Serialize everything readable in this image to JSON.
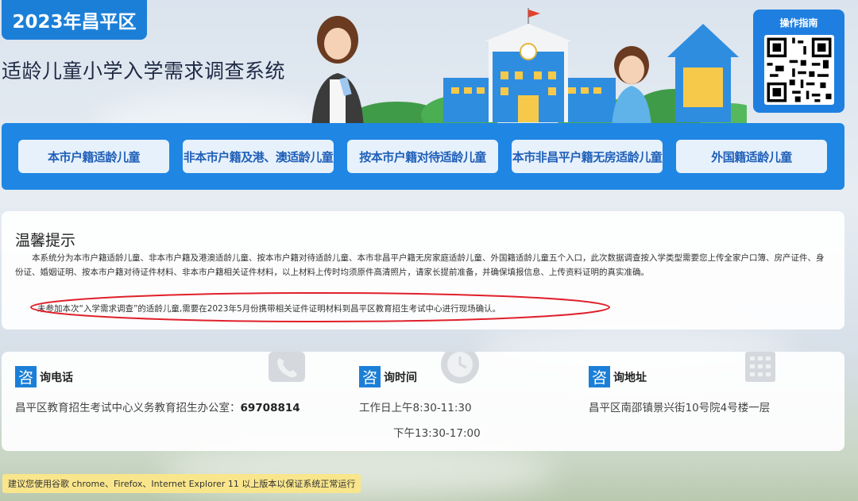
{
  "header": {
    "region_badge": "2023年昌平区",
    "system_title": "适龄儿童小学入学需求调查系统",
    "guide_label": "操作指南"
  },
  "nav": {
    "buttons": [
      "本市户籍适龄儿童",
      "非本市户籍及港、澳适龄儿童",
      "按本市户籍对待适龄儿童",
      "本市非昌平户籍无房适龄儿童",
      "外国籍适龄儿童"
    ]
  },
  "tips": {
    "title": "温馨提示",
    "body": "本系统分为本市户籍适龄儿童、非本市户籍及港澳适龄儿童、按本市户籍对待适龄儿童、本市非昌平户籍无房家庭适龄儿童、外国籍适龄儿童五个入口，此次数据调查按入学类型需要您上传全家户口簿、房产证件、身份证、婚姻证明、按本市户籍对待证件材料、非本市户籍相关证件材料，以上材料上传时均须原件高清照片，请家长提前准备，并确保填报信息、上传资料证明的真实准确。",
    "note": "未参加本次“入学需求调查”的适龄儿童,需要在2023年5月份携带相关证件证明材料到昌平区教育招生考试中心进行现场确认。"
  },
  "contact": {
    "zi": "咨",
    "phone": {
      "title": "询电话",
      "office": "昌平区教育招生考试中心义务教育招生办公室：",
      "number": "69708814"
    },
    "hours": {
      "title": "询时间",
      "weekday": "工作日上午8:30-11:30",
      "afternoon": "下午13:30-17:00"
    },
    "address": {
      "title": "询地址",
      "text": "昌平区南邵镇景兴街10号院4号楼一层"
    }
  },
  "footer": {
    "browser_notice": "建议您使用谷歌 chrome、Firefox、Internet Explorer 11 以上版本以保证系统正常运行"
  },
  "colors": {
    "primary": "#1f86e4",
    "button_bg": "#e6f1fc",
    "button_text": "#1f5fb8",
    "highlight_ellipse": "#e0202a",
    "notice_bg": "#f9e68c"
  }
}
